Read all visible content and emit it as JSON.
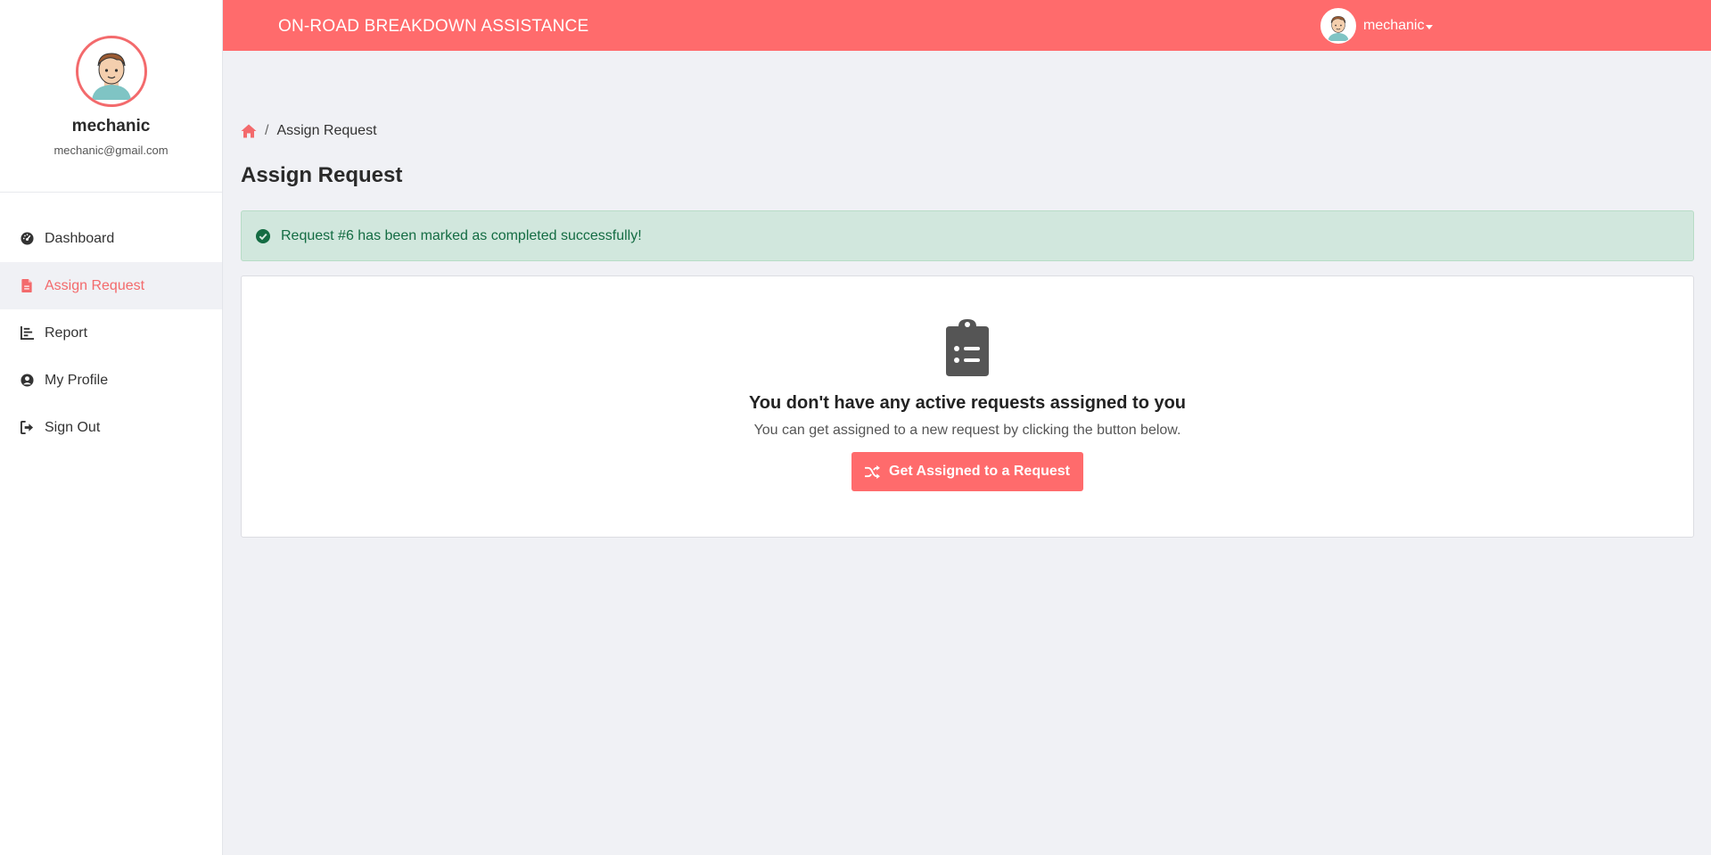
{
  "app": {
    "brand": "ON-ROAD BREAKDOWN ASSISTANCE",
    "accent_color": "#ff6b6c"
  },
  "topbar": {
    "user_name": "mechanic",
    "user_menu_icon": "caret-down-icon"
  },
  "sidebar": {
    "profile": {
      "name": "mechanic",
      "email": "mechanic@gmail.com"
    },
    "items": [
      {
        "label": "Dashboard",
        "icon": "speedometer-icon",
        "active": false
      },
      {
        "label": "Assign Request",
        "icon": "file-icon",
        "active": true
      },
      {
        "label": "Report",
        "icon": "chart-icon",
        "active": false
      },
      {
        "label": "My Profile",
        "icon": "user-circle-icon",
        "active": false
      },
      {
        "label": "Sign Out",
        "icon": "sign-out-icon",
        "active": false
      }
    ]
  },
  "breadcrumb": {
    "home_icon": "home-icon",
    "separator": "/",
    "current": "Assign Request"
  },
  "page": {
    "title": "Assign Request"
  },
  "alert": {
    "message": "Request #6 has been marked as completed successfully!",
    "icon": "check-circle-icon",
    "color": "#146c43"
  },
  "empty_state": {
    "icon": "clipboard-list-icon",
    "title": "You don't have any active requests assigned to you",
    "subtitle": "You can get assigned to a new request by clicking the button below.",
    "button_label": "Get Assigned to a Request",
    "button_icon": "shuffle-icon"
  }
}
